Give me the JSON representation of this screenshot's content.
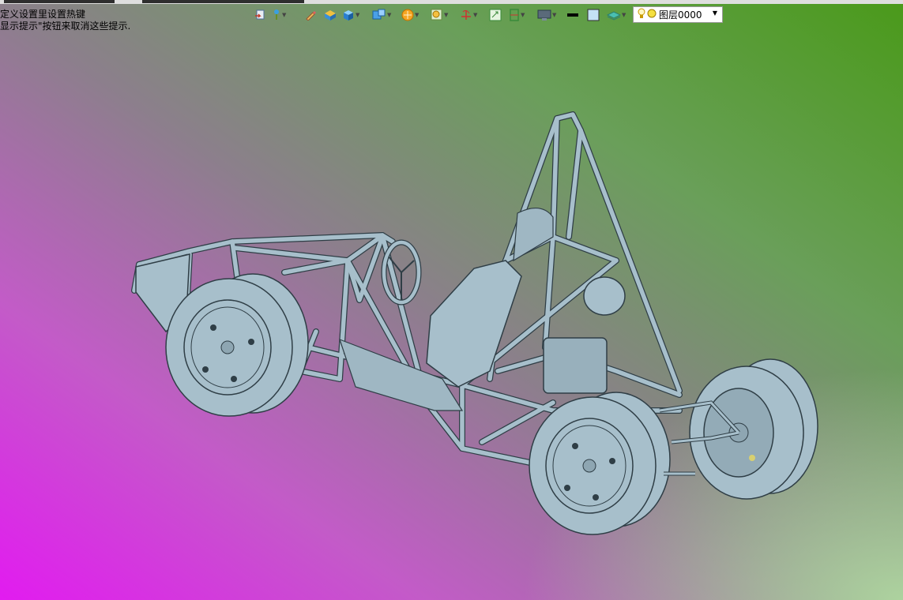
{
  "hints": {
    "line1": "定义设置里设置热键",
    "line2": "显示提示\"按钮来取消这些提示."
  },
  "toolbar": {
    "icons": [
      "select-icon",
      "point-icon",
      "sketch-icon",
      "extrude-icon",
      "solid-icon",
      "view-icon",
      "render-icon",
      "zoom-icon",
      "coordinate-icon",
      "fit-icon",
      "frame-icon",
      "display-icon",
      "line-color-icon",
      "face-color-icon",
      "layer-icon"
    ]
  },
  "layer": {
    "name": "图层0000"
  },
  "colors": {
    "model": "#a7bfcb",
    "model_edge": "#2f3e46"
  }
}
